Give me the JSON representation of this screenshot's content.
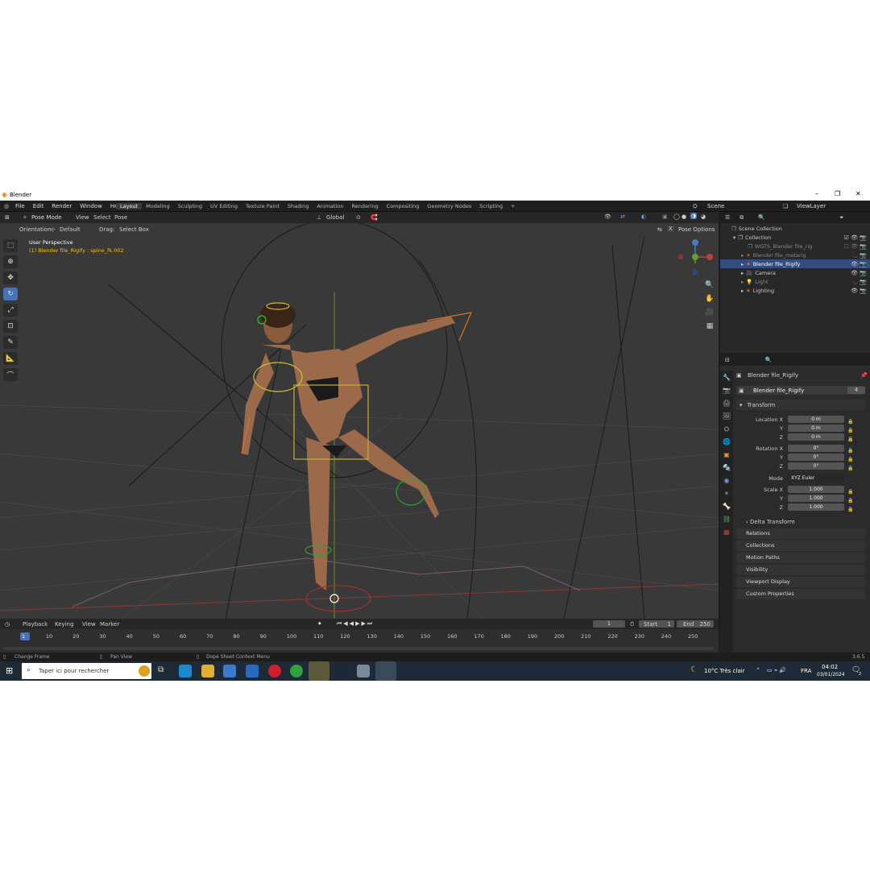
{
  "window": {
    "title": "Blender",
    "min_glyph": "–",
    "max_glyph": "❐",
    "close_glyph": "✕"
  },
  "menu": [
    "File",
    "Edit",
    "Render",
    "Window",
    "Help"
  ],
  "workspaces": [
    {
      "label": "Layout",
      "active": true
    },
    {
      "label": "Modeling"
    },
    {
      "label": "Sculpting"
    },
    {
      "label": "UV Editing"
    },
    {
      "label": "Texture Paint"
    },
    {
      "label": "Shading"
    },
    {
      "label": "Animation"
    },
    {
      "label": "Rendering"
    },
    {
      "label": "Compositing"
    },
    {
      "label": "Geometry Nodes"
    },
    {
      "label": "Scripting"
    }
  ],
  "add_workspace_glyph": "+",
  "scene": {
    "label": "Scene",
    "viewlayer": "ViewLayer"
  },
  "viewport_header": {
    "mode": "Pose Mode",
    "items": [
      "View",
      "Select",
      "Pose"
    ],
    "transform": "Global"
  },
  "viewport_header2": {
    "orientation_label": "Orientation:",
    "orientation": "Default",
    "drag_label": "Drag:",
    "drag": "Select Box",
    "pose_options": "Pose Options",
    "x_label": "X"
  },
  "viewport_info": {
    "perspective": "User Perspective",
    "object": "(1) Blender file_Rigify : spine_fk.002"
  },
  "outliner": {
    "rows": [
      {
        "label": "Scene Collection",
        "indent": 0
      },
      {
        "label": "Collection",
        "indent": 1
      },
      {
        "label": "WGTS_Blender file_rig",
        "indent": 2,
        "dim": true
      },
      {
        "label": "Blender file_metarig",
        "indent": 2,
        "dim": true
      },
      {
        "label": "Blender file_Rigify",
        "indent": 2,
        "selected": true
      },
      {
        "label": "Camera",
        "indent": 2
      },
      {
        "label": "Light",
        "indent": 2,
        "dim": true
      },
      {
        "label": "Lighting",
        "indent": 2
      }
    ]
  },
  "properties": {
    "object_name": "Blender file_Rigify",
    "data_name": "Blender file_Rigify",
    "users": "4",
    "transform_label": "Transform",
    "location": {
      "label": "Location X",
      "x": "0 m",
      "y": "0 m",
      "z": "0 m"
    },
    "rotation": {
      "label": "Rotation X",
      "x": "0°",
      "y": "0°",
      "z": "0°"
    },
    "mode": {
      "label": "Mode",
      "value": "XYZ Euler"
    },
    "scale": {
      "label": "Scale X",
      "x": "1.000",
      "y": "1.000",
      "z": "1.000"
    },
    "axis_y": "Y",
    "axis_z": "Z",
    "delta": "Delta Transform",
    "panels": [
      "Relations",
      "Collections",
      "Motion Paths",
      "Visibility",
      "Viewport Display",
      "Custom Properties"
    ]
  },
  "timeline": {
    "menus": [
      "Playback",
      "Keying",
      "View",
      "Marker"
    ],
    "current_frame": "1",
    "start_label": "Start",
    "start": "1",
    "end_label": "End",
    "end": "250",
    "ticks": [
      "1",
      "10",
      "20",
      "30",
      "40",
      "50",
      "60",
      "70",
      "80",
      "90",
      "100",
      "110",
      "120",
      "130",
      "140",
      "150",
      "160",
      "170",
      "180",
      "190",
      "200",
      "210",
      "220",
      "230",
      "240",
      "250"
    ]
  },
  "status": {
    "left": "Change Frame",
    "mid": "Pan View",
    "right": "Dope Sheet Context Menu",
    "version": "3.6.5"
  },
  "taskbar": {
    "search_placeholder": "Taper ici pour rechercher",
    "weather": "10°C  Très clair",
    "lang": "FRA",
    "time": "04:02",
    "date": "03/01/2024",
    "notif": "2"
  },
  "colors": {
    "accent": "#4772b3",
    "viewport": "#393939",
    "selected_row": "#334d80"
  }
}
